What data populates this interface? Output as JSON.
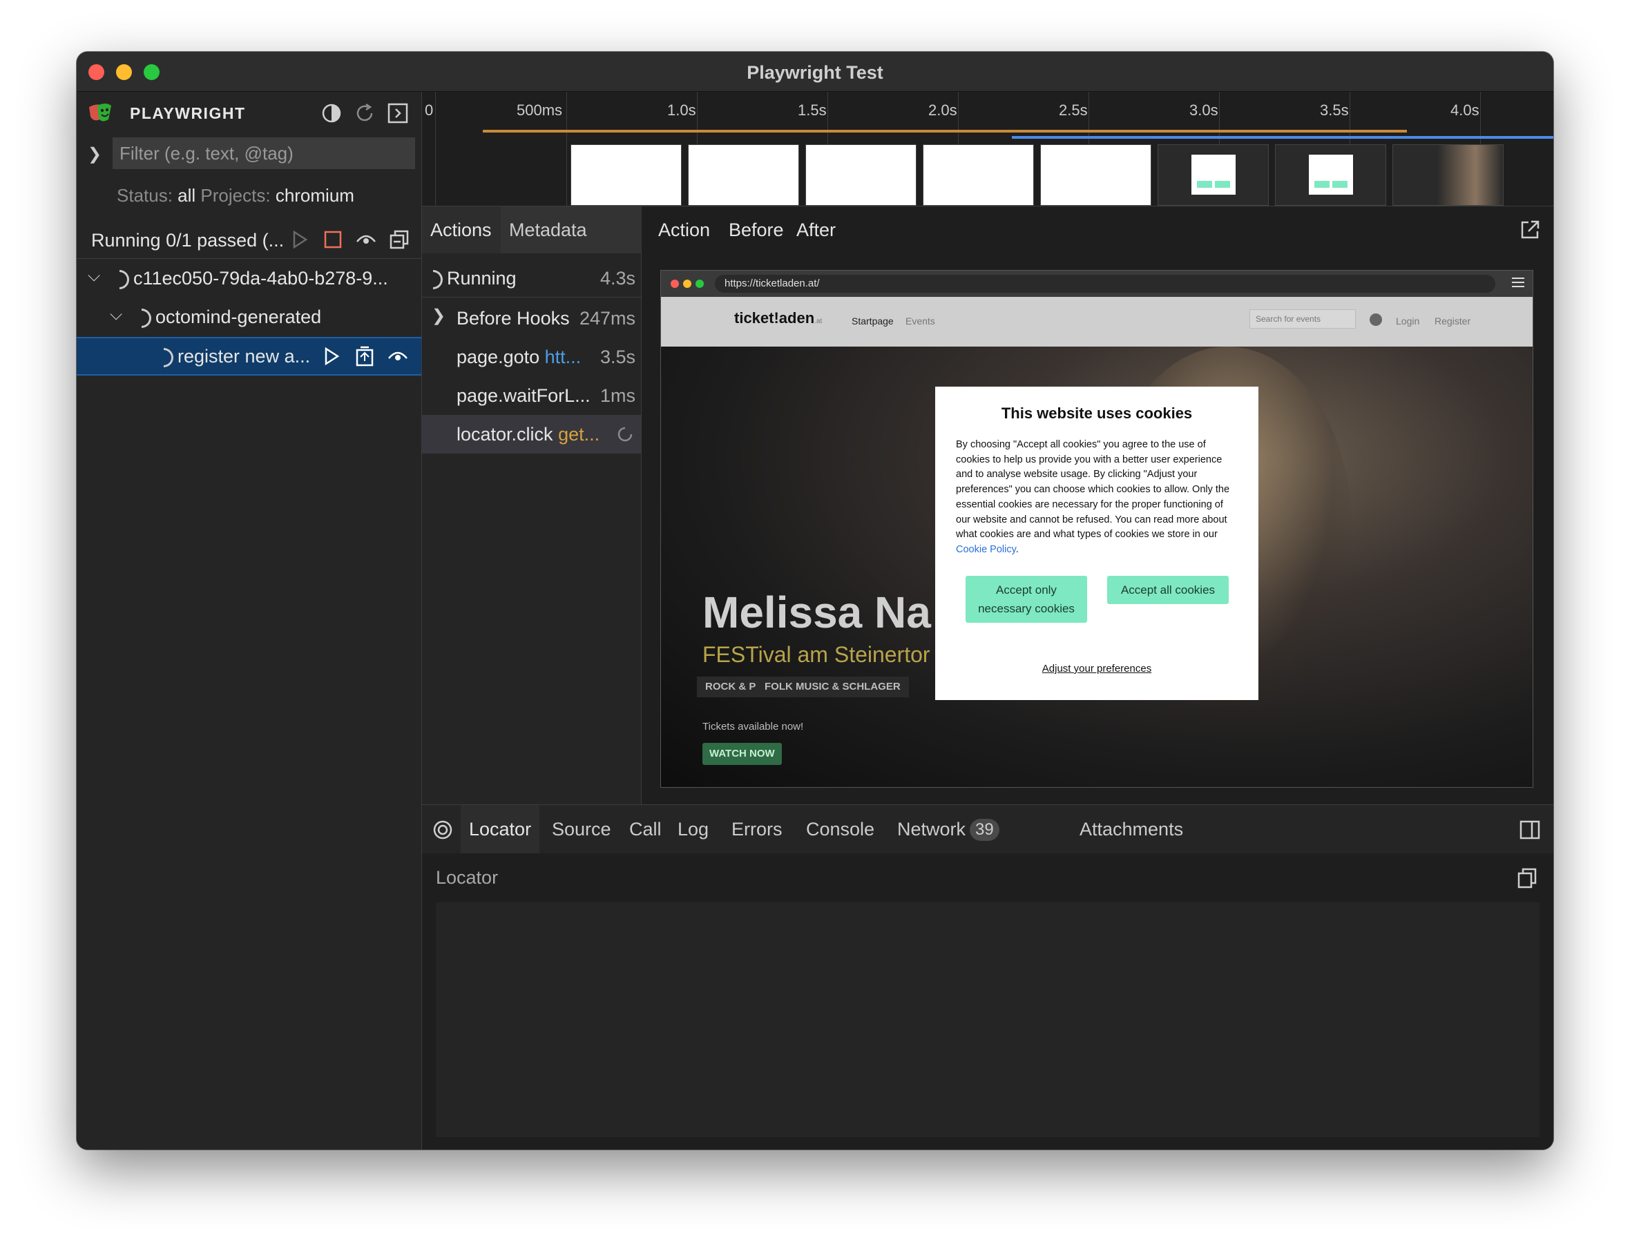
{
  "window": {
    "title": "Playwright Test"
  },
  "sidebar": {
    "brand": "PLAYWRIGHT",
    "filter_placeholder": "Filter (e.g. text, @tag)",
    "status_label": "Status:",
    "status_value": "all",
    "projects_label": "Projects:",
    "projects_value": "chromium",
    "running_text": "Running 0/1 passed (...",
    "tree": [
      {
        "label": "c11ec050-79da-4ab0-b278-9..."
      },
      {
        "label": "octomind-generated"
      },
      {
        "label": "register new a..."
      }
    ],
    "icons": [
      "theme-toggle-icon",
      "reload-icon",
      "collapse-panel-icon",
      "chevron-right-icon",
      "play-icon",
      "stop-icon",
      "watch-eye-icon",
      "collapse-all-icon",
      "chevron-down-icon",
      "spinner-icon",
      "open-trace-icon"
    ]
  },
  "timeline": {
    "ticks": [
      "0",
      "500ms",
      "1.0s",
      "1.5s",
      "2.0s",
      "2.5s",
      "3.0s",
      "3.5s",
      "4.0s"
    ],
    "thumbnail_count": 8
  },
  "actions_panel": {
    "tabs": [
      "Actions",
      "Metadata"
    ],
    "items": [
      {
        "name": "Running",
        "time": "4.3s"
      },
      {
        "name": "Before Hooks",
        "time": "247ms"
      },
      {
        "name": "page.goto",
        "detail": "htt...",
        "time": "3.5s"
      },
      {
        "name": "page.waitForL...",
        "time": "1ms"
      },
      {
        "name": "locator.click",
        "detail": "get..."
      }
    ]
  },
  "preview": {
    "tabs": [
      "Action",
      "Before",
      "After"
    ],
    "browser": {
      "url": "https://ticketladen.at/",
      "site_logo": "ticket!aden",
      "site_logo_suffix": ".at",
      "nav": [
        "Startpage",
        "Events"
      ],
      "search_placeholder": "Search for events",
      "login": "Login",
      "register": "Register",
      "hero_name": "Melissa Na",
      "hero_subtitle": "FESTival am Steinertor",
      "genres": [
        "ROCK & POP",
        "FOLK MUSIC & SCHLAGER"
      ],
      "tickets_text": "Tickets available now!",
      "watch_button": "WATCH NOW"
    },
    "cookie_modal": {
      "title": "This website uses cookies",
      "body": "By choosing \"Accept all cookies\" you agree to the use of cookies to help us provide you with a better user experience and to analyse website usage. By clicking \"Adjust your preferences\" you can choose which cookies to allow. Only the essential cookies are necessary for the proper functioning of our website and cannot be refused. You can read more about what cookies are and what types of cookies we store in our",
      "policy_link": "Cookie Policy",
      "policy_suffix": ".",
      "btn_necessary": "Accept only necessary cookies",
      "btn_all": "Accept all cookies",
      "adjust": "Adjust your preferences"
    }
  },
  "bottom_panel": {
    "tabs": [
      "Locator",
      "Source",
      "Call",
      "Log",
      "Errors",
      "Console",
      "Network",
      "Attachments"
    ],
    "network_count": "39",
    "locator_label": "Locator"
  },
  "colors": {
    "accent_blue": "#4f9de8",
    "accent_orange": "#d7a140",
    "selection": "#0f3c6a",
    "cookie_button": "#7ee8c2",
    "stop_red": "#f0705a"
  }
}
